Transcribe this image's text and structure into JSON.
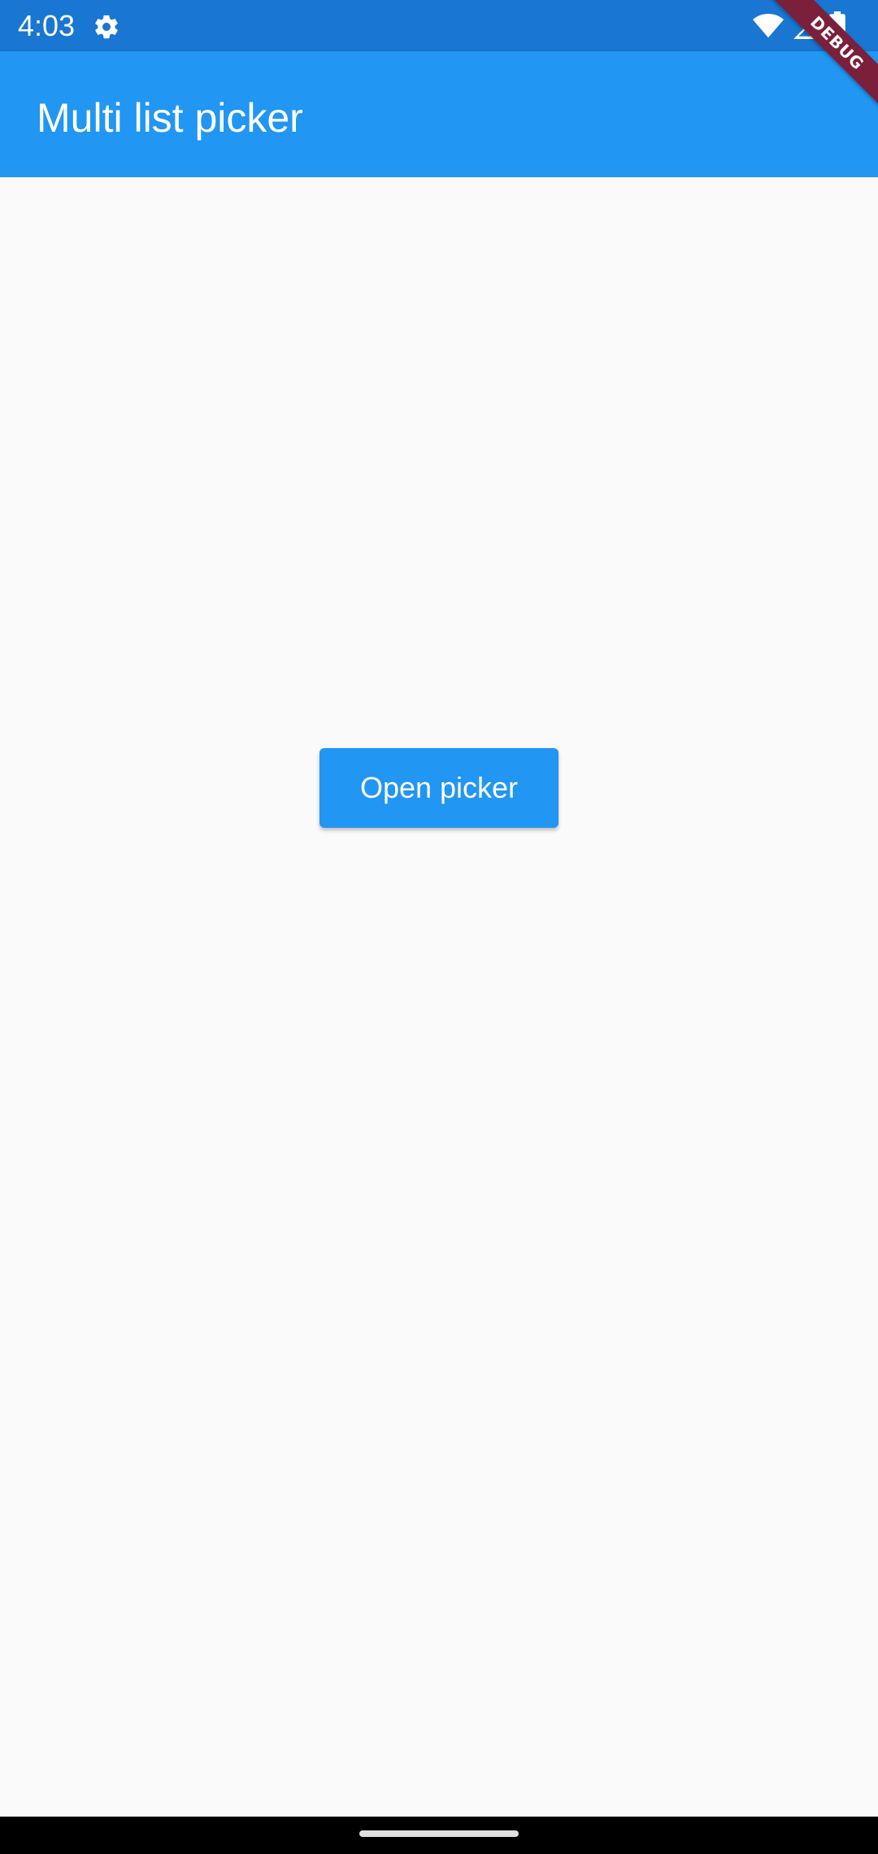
{
  "status_bar": {
    "time": "4:03",
    "icons": [
      "gear-icon",
      "wifi-icon",
      "signal-icon",
      "battery-icon"
    ]
  },
  "debug_banner": {
    "label": "DEBUG"
  },
  "app_bar": {
    "title": "Multi list picker"
  },
  "main": {
    "open_picker_label": "Open picker"
  },
  "colors": {
    "status_bar": "#1976d2",
    "app_bar": "#2196f3",
    "button": "#2196f3",
    "background": "#fafafa",
    "debug_ribbon": "#7b1f3a"
  }
}
